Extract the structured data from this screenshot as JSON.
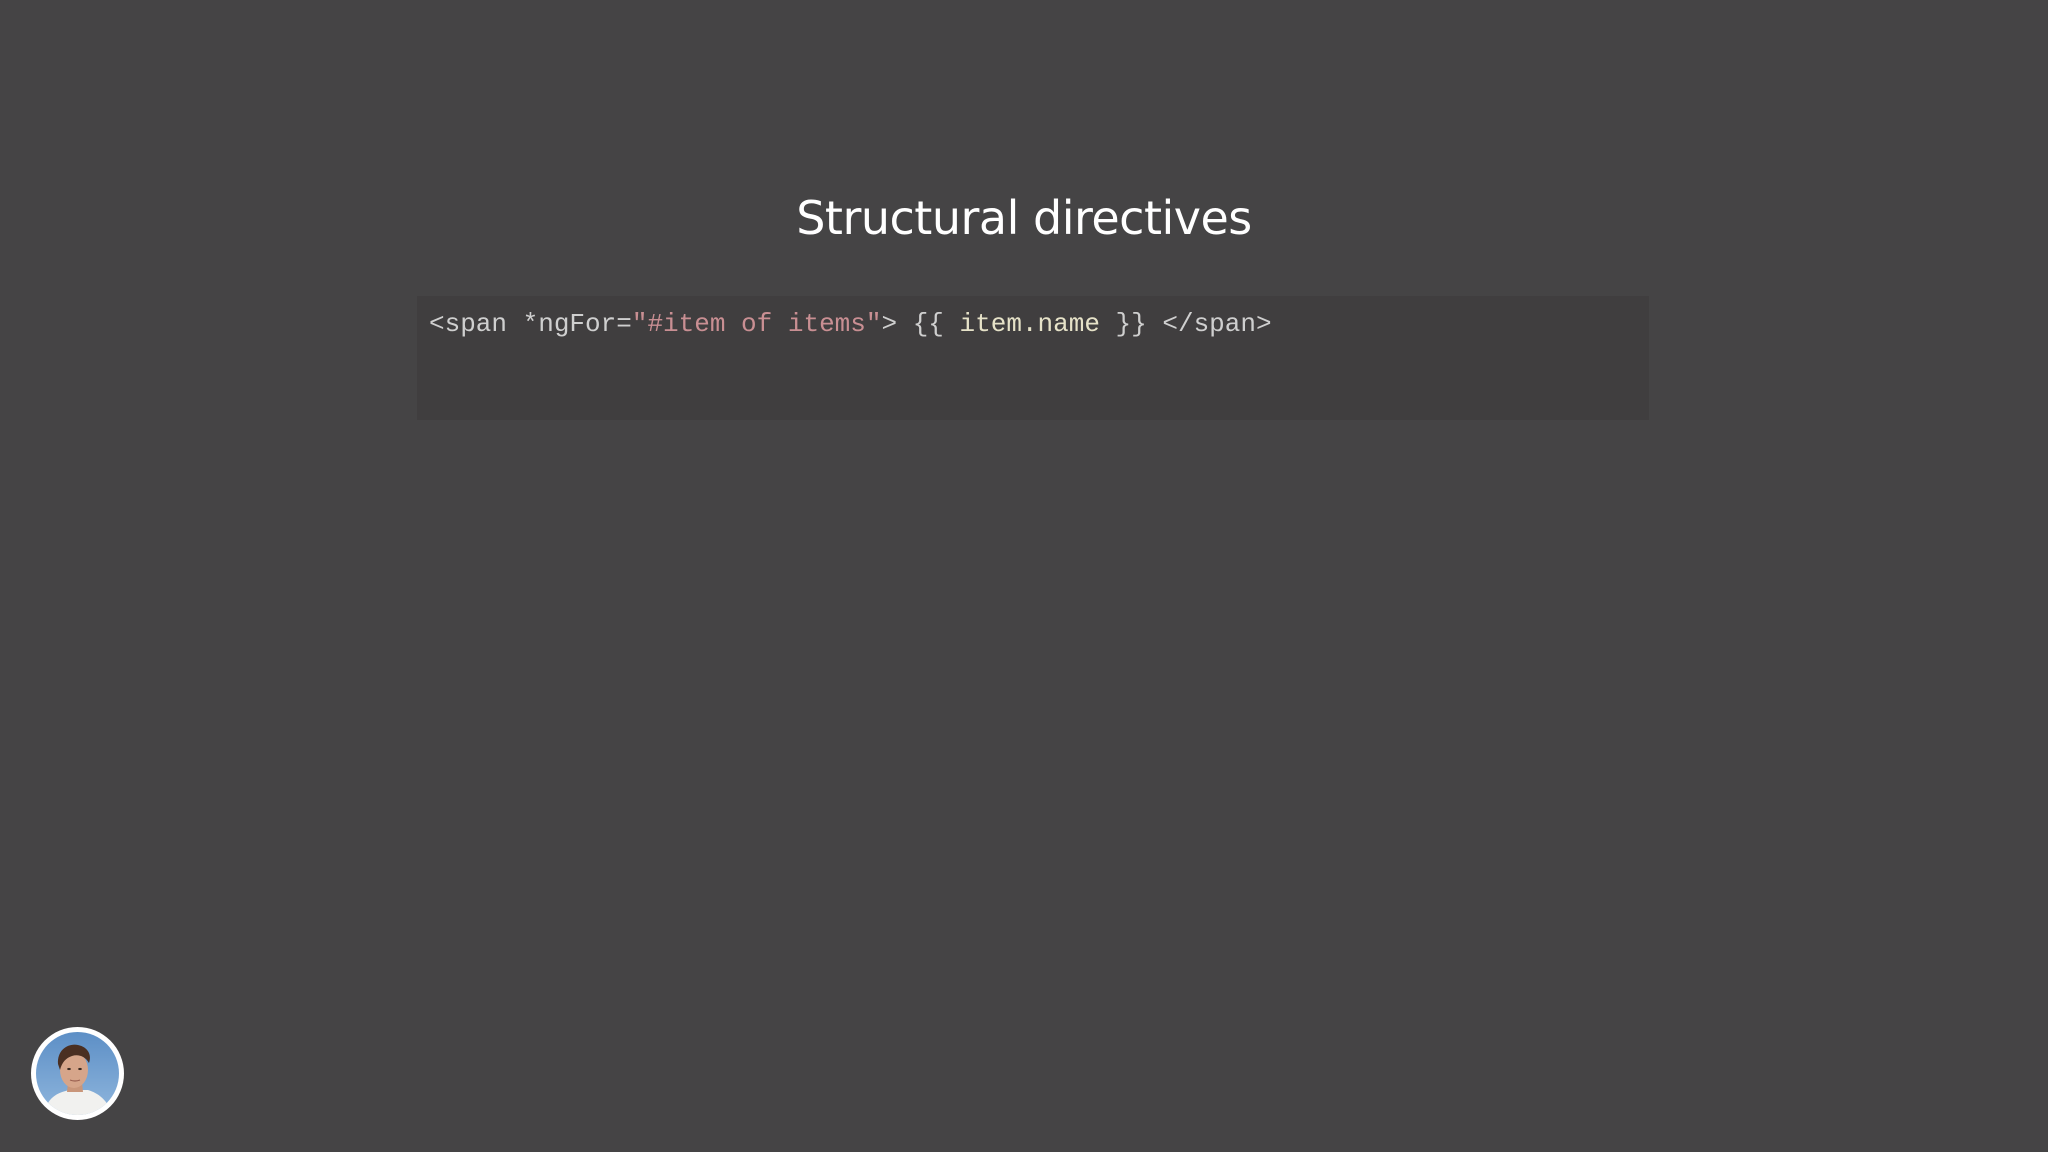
{
  "slide": {
    "title": "Structural directives",
    "code": {
      "open_tag": "<span ",
      "attr_name": "*ngFor=",
      "attr_value": "\"#item of items\"",
      "open_tag_close": "> ",
      "interp_open": "{{ ",
      "interp_expr": "item.name",
      "interp_close": " }}",
      "close_tag": " </span>"
    }
  },
  "presenter": {
    "avatar_icon": "presenter-avatar"
  },
  "colors": {
    "background": "#454445",
    "code_background": "#403e3f",
    "code_text": "#cfcfcf",
    "string": "#c98f93",
    "title": "#ffffff"
  }
}
